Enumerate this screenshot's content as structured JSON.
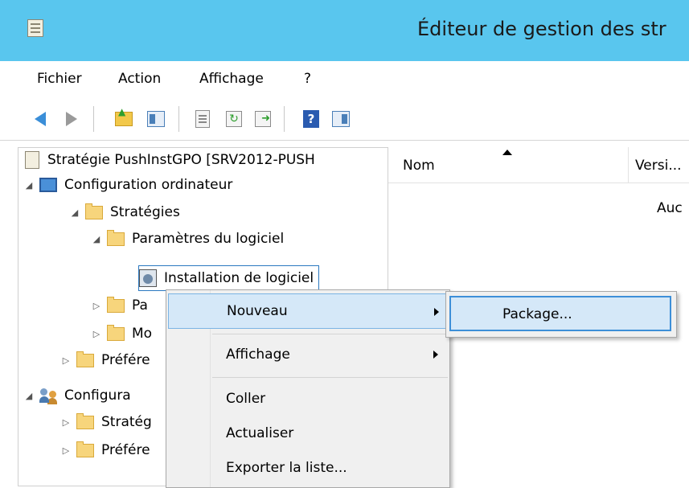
{
  "window": {
    "title": "Éditeur de gestion des str"
  },
  "menubar": {
    "items": [
      "Fichier",
      "Action",
      "Affichage",
      "?"
    ]
  },
  "toolbar": {
    "buttons": [
      "back-arrow-icon",
      "forward-arrow-icon",
      "folder-up-icon",
      "show-hide-console-tree-icon",
      "properties-icon",
      "refresh-icon",
      "export-list-icon",
      "help-icon",
      "show-hide-action-pane-icon"
    ]
  },
  "tree": {
    "root": "Stratégie PushInstGPO [SRV2012-PUSH",
    "computer_config": "Configuration ordinateur",
    "strategies": "Stratégies",
    "software_settings": "Paramètres du logiciel",
    "software_install": "Installation de logiciel",
    "partial_pa": "Pa",
    "partial_mo": "Mo",
    "partial_prefere": "Préfére",
    "partial_configura": "Configura",
    "partial_strateg": "Stratég",
    "partial_prefere2": "Préfére"
  },
  "list": {
    "col_name": "Nom",
    "col_version": "Versi...",
    "empty_message": "Auc"
  },
  "context_menu": {
    "nouveau": "Nouveau",
    "affichage": "Affichage",
    "coller": "Coller",
    "actualiser": "Actualiser",
    "exporter": "Exporter la liste..."
  },
  "submenu": {
    "package": "Package..."
  }
}
